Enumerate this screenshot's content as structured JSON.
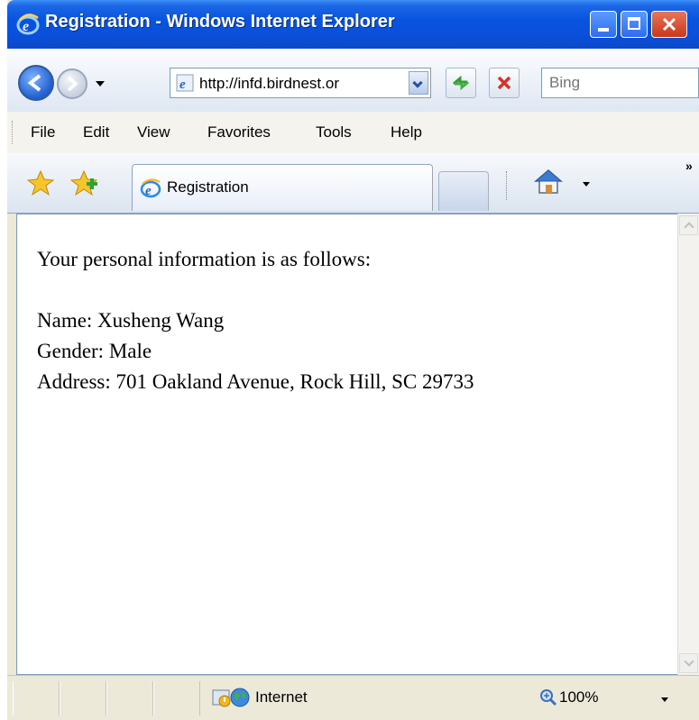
{
  "window": {
    "title": "Registration - Windows Internet Explorer"
  },
  "navbar": {
    "address": "http://infd.birdnest.or",
    "search_placeholder": "Bing"
  },
  "menu": {
    "items": [
      "File",
      "Edit",
      "View",
      "Favorites",
      "Tools",
      "Help"
    ]
  },
  "tabs": {
    "active_label": "Registration"
  },
  "content": {
    "heading": "Your personal information is as follows:",
    "name": "Name: Xusheng Wang",
    "gender": "Gender: Male",
    "address": "Address: 701 Oakland Avenue, Rock Hill, SC 29733"
  },
  "status": {
    "zone": "Internet",
    "zoom": "100%"
  },
  "colors": {
    "titlebar": "#0854e0",
    "close_button": "#c9381a",
    "chrome": "#ece9d8"
  }
}
